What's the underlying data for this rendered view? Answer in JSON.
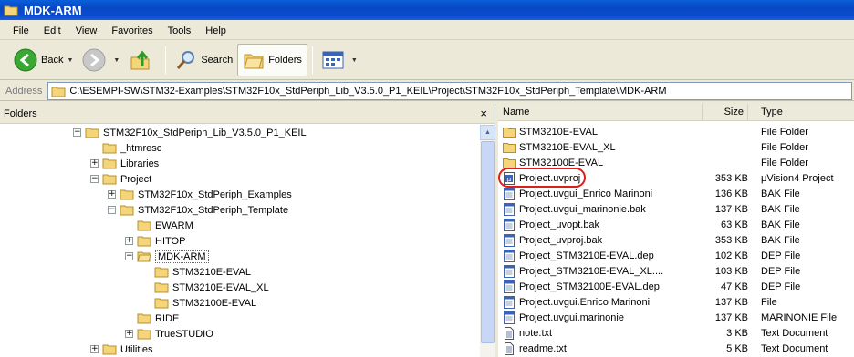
{
  "window": {
    "title": "MDK-ARM"
  },
  "menu": [
    "File",
    "Edit",
    "View",
    "Favorites",
    "Tools",
    "Help"
  ],
  "toolbar": {
    "back_label": "Back",
    "search_label": "Search",
    "folders_label": "Folders"
  },
  "address": {
    "label": "Address",
    "path": "C:\\ESEMPI-SW\\STM32-Examples\\STM32F10x_StdPeriph_Lib_V3.5.0_P1_KEIL\\Project\\STM32F10x_StdPeriph_Template\\MDK-ARM"
  },
  "folders_pane": {
    "title": "Folders",
    "close": "×",
    "tree": [
      {
        "label": "STM32F10x_StdPeriph_Lib_V3.5.0_P1_KEIL",
        "toggle": "-"
      },
      {
        "label": "_htmresc",
        "toggle": ""
      },
      {
        "label": "Libraries",
        "toggle": "+"
      },
      {
        "label": "Project",
        "toggle": "-"
      },
      {
        "label": "STM32F10x_StdPeriph_Examples",
        "toggle": "+"
      },
      {
        "label": "STM32F10x_StdPeriph_Template",
        "toggle": "-"
      },
      {
        "label": "EWARM",
        "toggle": ""
      },
      {
        "label": "HITOP",
        "toggle": "+"
      },
      {
        "label": "MDK-ARM",
        "toggle": "-",
        "selected": true
      },
      {
        "label": "STM3210E-EVAL",
        "toggle": ""
      },
      {
        "label": "STM3210E-EVAL_XL",
        "toggle": ""
      },
      {
        "label": "STM32100E-EVAL",
        "toggle": ""
      },
      {
        "label": "RIDE",
        "toggle": ""
      },
      {
        "label": "TrueSTUDIO",
        "toggle": "+"
      },
      {
        "label": "Utilities",
        "toggle": "+"
      }
    ]
  },
  "file_list": {
    "columns": [
      "Name",
      "Size",
      "Type"
    ],
    "rows": [
      {
        "name": "STM3210E-EVAL",
        "size": "",
        "type": "File Folder",
        "icon": "folder-icon"
      },
      {
        "name": "STM3210E-EVAL_XL",
        "size": "",
        "type": "File Folder",
        "icon": "folder-icon"
      },
      {
        "name": "STM32100E-EVAL",
        "size": "",
        "type": "File Folder",
        "icon": "folder-icon"
      },
      {
        "name": "Project.uvproj",
        "size": "353 KB",
        "type": "µVision4 Project",
        "icon": "uvision-project-icon",
        "highlighted": true
      },
      {
        "name": "Project.uvgui_Enrico Marinoni",
        "size": "136 KB",
        "type": "BAK File",
        "icon": "file-icon"
      },
      {
        "name": "Project.uvgui_marinonie.bak",
        "size": "137 KB",
        "type": "BAK File",
        "icon": "file-icon"
      },
      {
        "name": "Project_uvopt.bak",
        "size": "63 KB",
        "type": "BAK File",
        "icon": "file-icon"
      },
      {
        "name": "Project_uvproj.bak",
        "size": "353 KB",
        "type": "BAK File",
        "icon": "file-icon"
      },
      {
        "name": "Project_STM3210E-EVAL.dep",
        "size": "102 KB",
        "type": "DEP File",
        "icon": "file-icon"
      },
      {
        "name": "Project_STM3210E-EVAL_XL....",
        "size": "103 KB",
        "type": "DEP File",
        "icon": "file-icon"
      },
      {
        "name": "Project_STM32100E-EVAL.dep",
        "size": "47 KB",
        "type": "DEP File",
        "icon": "file-icon"
      },
      {
        "name": "Project.uvgui.Enrico Marinoni",
        "size": "137 KB",
        "type": "File",
        "icon": "file-icon"
      },
      {
        "name": "Project.uvgui.marinonie",
        "size": "137 KB",
        "type": "MARINONIE File",
        "icon": "file-icon"
      },
      {
        "name": "note.txt",
        "size": "3 KB",
        "type": "Text Document",
        "icon": "text-file-icon"
      },
      {
        "name": "readme.txt",
        "size": "5 KB",
        "type": "Text Document",
        "icon": "text-file-icon"
      }
    ]
  },
  "colors": {
    "titlebar": "#0a4ed0",
    "highlight_circle": "#e01b1b",
    "folder": "#f4d57a"
  }
}
